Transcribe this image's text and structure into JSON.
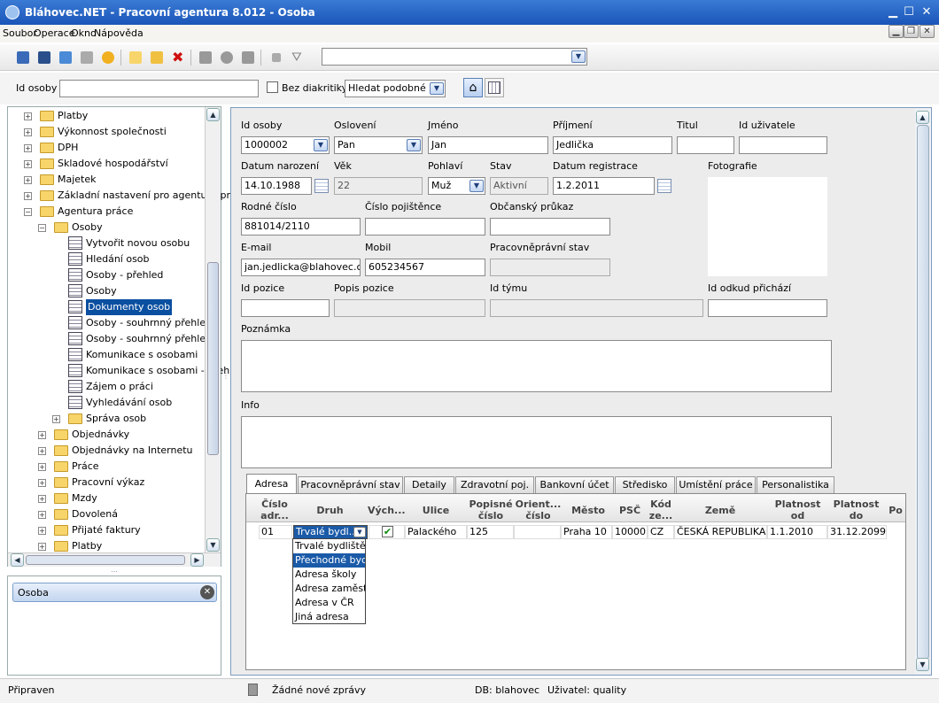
{
  "window": {
    "title": "Bláhovec.NET - Pracovní agentura 8.012 - Osoba",
    "min": "▁",
    "max": "☐",
    "close": "✕"
  },
  "menu": [
    "Soubor",
    "Operace",
    "Okno",
    "Nápověda"
  ],
  "mdi": {
    "min": "▁",
    "restore": "❐",
    "close": "✕"
  },
  "search": {
    "label": "Id osoby",
    "value": "",
    "diacritics_label": "Bez diakritiky",
    "mode": "Hledat podobné"
  },
  "tree": [
    {
      "label": "Platby",
      "level": 1,
      "type": "folder",
      "pm": "+"
    },
    {
      "label": "Výkonnost společnosti",
      "level": 1,
      "type": "folder",
      "pm": "+"
    },
    {
      "label": "DPH",
      "level": 1,
      "type": "folder",
      "pm": "+"
    },
    {
      "label": "Skladové hospodářství",
      "level": 1,
      "type": "folder",
      "pm": "+"
    },
    {
      "label": "Majetek",
      "level": 1,
      "type": "folder",
      "pm": "+"
    },
    {
      "label": "Základní nastavení pro agenturu pr",
      "level": 1,
      "type": "folder",
      "pm": "+"
    },
    {
      "label": "Agentura práce",
      "level": 1,
      "type": "folder",
      "pm": "−"
    },
    {
      "label": "Osoby",
      "level": 2,
      "type": "folder",
      "pm": "−"
    },
    {
      "label": "Vytvořit novou osobu",
      "level": 3,
      "type": "doc"
    },
    {
      "label": "Hledání osob",
      "level": 3,
      "type": "doc"
    },
    {
      "label": "Osoby - přehled",
      "level": 3,
      "type": "doc"
    },
    {
      "label": "Osoby",
      "level": 3,
      "type": "doc"
    },
    {
      "label": "Dokumenty osob",
      "level": 3,
      "type": "doc",
      "selected": true
    },
    {
      "label": "Osoby - souhrnný přehled",
      "level": 3,
      "type": "doc"
    },
    {
      "label": "Osoby - souhrnný přehled",
      "level": 3,
      "type": "doc"
    },
    {
      "label": "Komunikace s osobami",
      "level": 3,
      "type": "doc"
    },
    {
      "label": "Komunikace s osobami - přeh",
      "level": 3,
      "type": "doc"
    },
    {
      "label": "Zájem o práci",
      "level": 3,
      "type": "doc"
    },
    {
      "label": "Vyhledávání osob",
      "level": 3,
      "type": "doc"
    },
    {
      "label": "Správa osob",
      "level": 3,
      "type": "folder",
      "pm": "+"
    },
    {
      "label": "Objednávky",
      "level": 2,
      "type": "folder",
      "pm": "+"
    },
    {
      "label": "Objednávky na Internetu",
      "level": 2,
      "type": "folder",
      "pm": "+"
    },
    {
      "label": "Práce",
      "level": 2,
      "type": "folder",
      "pm": "+"
    },
    {
      "label": "Pracovní výkaz",
      "level": 2,
      "type": "folder",
      "pm": "+"
    },
    {
      "label": "Mzdy",
      "level": 2,
      "type": "folder",
      "pm": "+"
    },
    {
      "label": "Dovolená",
      "level": 2,
      "type": "folder",
      "pm": "+"
    },
    {
      "label": "Přijaté faktury",
      "level": 2,
      "type": "folder",
      "pm": "+"
    },
    {
      "label": "Platby",
      "level": 2,
      "type": "folder",
      "pm": "+"
    }
  ],
  "panel": {
    "title": "Osoba"
  },
  "form": {
    "labels": {
      "id_osoby": "Id osoby",
      "osloveni": "Oslovení",
      "jmeno": "Jméno",
      "prijmeni": "Příjmení",
      "titul": "Titul",
      "id_uzivatele": "Id uživatele",
      "datum_narozeni": "Datum narození",
      "vek": "Věk",
      "pohlavi": "Pohlaví",
      "stav": "Stav",
      "datum_registrace": "Datum registrace",
      "fotografie": "Fotografie",
      "rodne_cislo": "Rodné číslo",
      "cislo_pojistence": "Číslo pojištěnce",
      "obcansky_prukaz": "Občanský průkaz",
      "email": "E-mail",
      "mobil": "Mobil",
      "pracovnepravni_stav": "Pracovněprávní stav",
      "id_pozice": "Id pozice",
      "popis_pozice": "Popis pozice",
      "id_tymu": "Id týmu",
      "id_odkud": "Id odkud přichází",
      "poznamka": "Poznámka",
      "info": "Info"
    },
    "values": {
      "id_osoby": "1000002",
      "osloveni": "Pan",
      "jmeno": "Jan",
      "prijmeni": "Jedlička",
      "titul": "",
      "id_uzivatele": "",
      "datum_narozeni": "14.10.1988",
      "vek": "22",
      "pohlavi": "Muž",
      "stav": "Aktivní",
      "datum_registrace": "1.2.2011",
      "rodne_cislo": "881014/2110",
      "cislo_pojistence": "",
      "obcansky_prukaz": "",
      "email": "jan.jedlicka@blahovec.cz",
      "mobil": "605234567",
      "pracovnepravni_stav": "",
      "id_pozice": "",
      "popis_pozice": "",
      "id_tymu": "",
      "id_odkud": ""
    }
  },
  "tabs": [
    "Adresa",
    "Pracovněprávní stav",
    "Detaily",
    "Zdravotní poj.",
    "Bankovní účet",
    "Středisko",
    "Umístění práce",
    "Personalistika"
  ],
  "grid": {
    "headers": [
      "Číslo adr...",
      "Druh",
      "Vých...",
      "Ulice",
      "Popisné číslo",
      "Orient... číslo",
      "Město",
      "PSČ",
      "Kód ze...",
      "Země",
      "Platnost od",
      "Platnost do",
      "Po"
    ],
    "row": {
      "cislo": "01",
      "druh": "Trvalé bydl...",
      "vych": "✔",
      "ulice": "Palackého",
      "popisne": "125",
      "orient": "",
      "mesto": "Praha 10",
      "psc": "10000",
      "kod": "CZ",
      "zeme": "ČESKÁ REPUBLIKA",
      "od": "1.1.2010",
      "do": "31.12.2099"
    },
    "dropdown": [
      "Trvalé bydliště",
      "Přechodné bydliště",
      "Adresa školy",
      "Adresa zaměstnání",
      "Adresa v ČR",
      "Jiná adresa"
    ]
  },
  "status": {
    "left": "Připraven",
    "messages": "Žádné nové zprávy",
    "db": "DB: blahovec",
    "user": "Uživatel: quality"
  }
}
